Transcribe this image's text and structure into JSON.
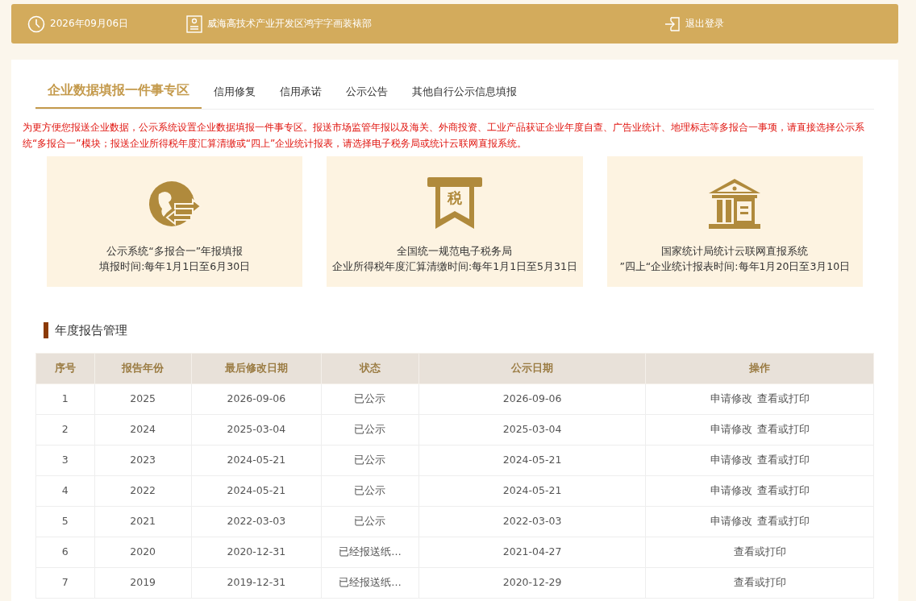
{
  "header": {
    "date": "2026年09月06日",
    "company": "威海高技术产业开发区鸿宇字画装裱部",
    "logout": "退出登录"
  },
  "tabs": [
    {
      "label": "企业数据填报一件事专区",
      "selected": true
    },
    {
      "label": "信用修复",
      "selected": false
    },
    {
      "label": "信用承诺",
      "selected": false
    },
    {
      "label": "公示公告",
      "selected": false
    },
    {
      "label": "其他自行公示信息填报",
      "selected": false
    }
  ],
  "notice": "为更方便您报送企业数据，公示系统设置企业数据填报一件事专区。报送市场监管年报以及海关、外商投资、工业产品获证企业年度自查、广告业统计、地理标志等多报合一事项，请直接选择公示系统“多报合一”模块；报送企业所得税年度汇算清缴或“四上”企业统计报表，请选择电子税务局或统计云联网直报系统。",
  "cards": [
    {
      "kind": "globe",
      "title": "公示系统“多报合一”年报填报",
      "subtitle": "填报时间:每年1月1日至6月30日"
    },
    {
      "kind": "tax",
      "icon_text": "税",
      "title": "全国统一规范电子税务局",
      "subtitle": "企业所得税年度汇算清缴时间:每年1月1日至5月31日"
    },
    {
      "kind": "bank",
      "title": "国家统计局统计云联网直报系统",
      "subtitle": "”四上“企业统计报表时间:每年1月20日至3月10日"
    }
  ],
  "section_title": "年度报告管理",
  "table": {
    "columns": [
      "序号",
      "报告年份",
      "最后修改日期",
      "状态",
      "公示日期",
      "操作"
    ],
    "rows": [
      {
        "cells": [
          "1",
          "2025",
          "2026-09-06",
          "已公示",
          "2026-09-06"
        ],
        "actions": [
          "申请修改",
          "查看或打印"
        ]
      },
      {
        "cells": [
          "2",
          "2024",
          "2025-03-04",
          "已公示",
          "2025-03-04"
        ],
        "actions": [
          "申请修改",
          "查看或打印"
        ]
      },
      {
        "cells": [
          "3",
          "2023",
          "2024-05-21",
          "已公示",
          "2024-05-21"
        ],
        "actions": [
          "申请修改",
          "查看或打印"
        ]
      },
      {
        "cells": [
          "4",
          "2022",
          "2024-05-21",
          "已公示",
          "2024-05-21"
        ],
        "actions": [
          "申请修改",
          "查看或打印"
        ]
      },
      {
        "cells": [
          "5",
          "2021",
          "2022-03-03",
          "已公示",
          "2022-03-03"
        ],
        "actions": [
          "申请修改",
          "查看或打印"
        ]
      },
      {
        "cells": [
          "6",
          "2020",
          "2020-12-31",
          "已经报送纸…",
          "2021-04-27"
        ],
        "actions": [
          "查看或打印"
        ]
      },
      {
        "cells": [
          "7",
          "2019",
          "2019-12-31",
          "已经报送纸…",
          "2020-12-29"
        ],
        "actions": [
          "查看或打印"
        ]
      }
    ]
  }
}
